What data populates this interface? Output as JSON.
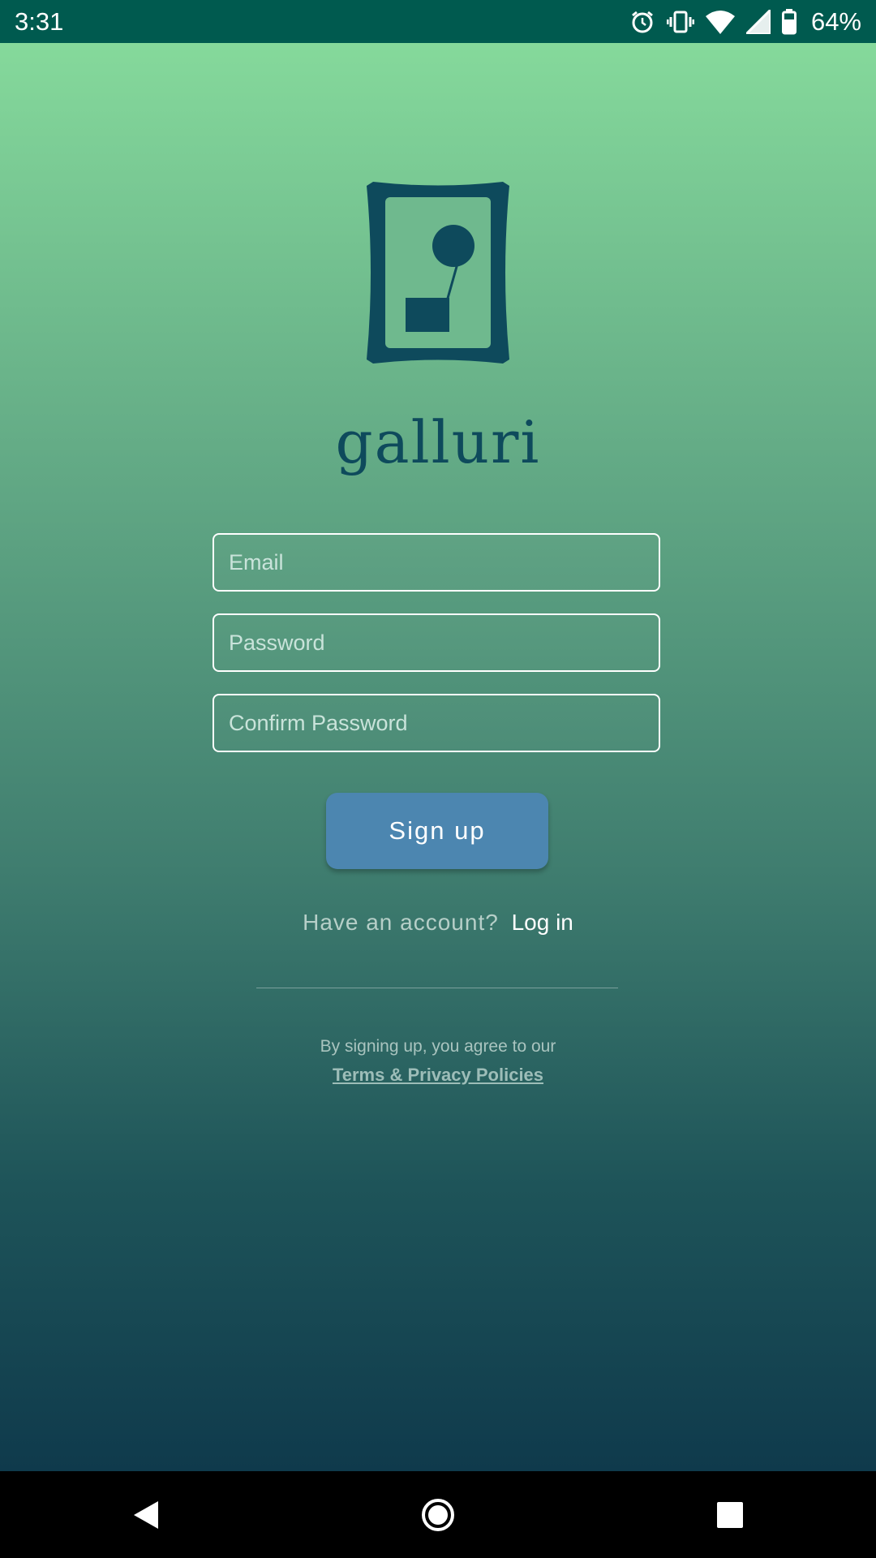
{
  "status_bar": {
    "time": "3:31",
    "battery": "64%",
    "icons": [
      "alarm-icon",
      "vibrate-icon",
      "wifi-icon",
      "cell-signal-icon",
      "battery-icon"
    ]
  },
  "app": {
    "name": "galluri",
    "logo": "picture-frame-logo",
    "brand_color": "#0e4a5c"
  },
  "form": {
    "email_placeholder": "Email",
    "password_placeholder": "Password",
    "confirm_placeholder": "Confirm Password",
    "signup_label": "Sign up"
  },
  "login": {
    "prompt": "Have an account?",
    "link": "Log in"
  },
  "terms": {
    "text": "By signing up, you agree to our",
    "link": "Terms & Privacy Policies"
  },
  "nav": {
    "icons": [
      "back-icon",
      "home-icon",
      "recents-icon"
    ]
  },
  "colors": {
    "gradient_top": "#85d99b",
    "gradient_bottom": "#0f3a4c",
    "button": "#4c86b0",
    "status_bar": "#005a4f"
  }
}
